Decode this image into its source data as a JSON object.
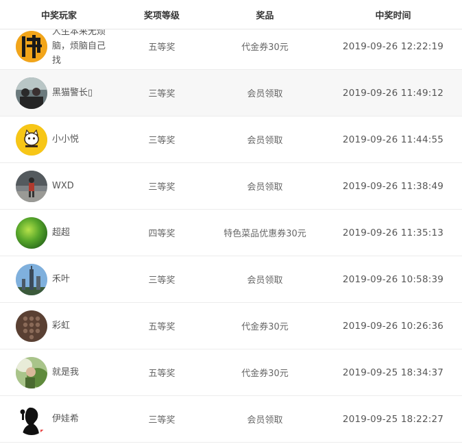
{
  "headers": {
    "player": "中奖玩家",
    "level": "奖项等级",
    "prize": "奖品",
    "time": "中奖时间"
  },
  "rows": [
    {
      "name": "人生本来无烦脑，烦脑自己找",
      "level": "五等奖",
      "prize": "代金券30元",
      "time": "2019-09-26 12:22:19",
      "avatar_icon": "buddha-character-icon"
    },
    {
      "name": "黑猫警长▯",
      "level": "三等奖",
      "prize": "会员领取",
      "time": "2019-09-26 11:49:12",
      "avatar_icon": "group-photo-icon"
    },
    {
      "name": "小小悦",
      "level": "三等奖",
      "prize": "会员领取",
      "time": "2019-09-26 11:44:55",
      "avatar_icon": "cartoon-cat-icon"
    },
    {
      "name": "WXD",
      "level": "三等奖",
      "prize": "会员领取",
      "time": "2019-09-26 11:38:49",
      "avatar_icon": "person-photo-icon"
    },
    {
      "name": "超超",
      "level": "四等奖",
      "prize": "特色菜品优惠券30元",
      "time": "2019-09-26 11:35:13",
      "avatar_icon": "green-blur-icon"
    },
    {
      "name": "禾叶",
      "level": "三等奖",
      "prize": "会员领取",
      "time": "2019-09-26 10:58:39",
      "avatar_icon": "city-skyline-icon"
    },
    {
      "name": "彩虹",
      "level": "五等奖",
      "prize": "代金券30元",
      "time": "2019-09-26 10:26:36",
      "avatar_icon": "phone-keypad-icon"
    },
    {
      "name": "就是我",
      "level": "五等奖",
      "prize": "代金券30元",
      "time": "2019-09-25 18:34:37",
      "avatar_icon": "nature-photo-icon"
    },
    {
      "name": "伊娃希",
      "level": "三等奖",
      "prize": "会员领取",
      "time": "2019-09-25 18:22:27",
      "avatar_icon": "silhouette-icon"
    }
  ]
}
